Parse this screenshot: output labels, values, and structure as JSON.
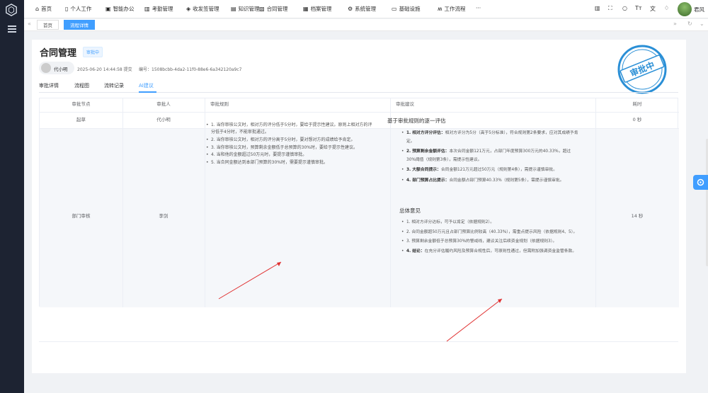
{
  "nav": [
    {
      "icon": "home-icon",
      "label": "首页"
    },
    {
      "icon": "person-icon",
      "label": "个人工作"
    },
    {
      "icon": "office-icon",
      "label": "智能办公"
    },
    {
      "icon": "chart-icon",
      "label": "考勤管理"
    },
    {
      "icon": "mail-icon",
      "label": "收发签管理"
    },
    {
      "icon": "book-icon",
      "label": "知识管理"
    },
    {
      "icon": "contract-icon",
      "label": "合同管理"
    },
    {
      "icon": "archive-icon",
      "label": "档案管理"
    },
    {
      "icon": "gear-icon",
      "label": "系统管理"
    },
    {
      "icon": "monitor-icon",
      "label": "基础设施"
    },
    {
      "icon": "workflow-icon",
      "label": "工作流程"
    },
    {
      "icon": "more-icon",
      "label": "···"
    }
  ],
  "user": {
    "name": "君风"
  },
  "tabs": {
    "home": "首页",
    "active": "流程详情"
  },
  "page": {
    "title": "合同管理",
    "status": "审批中",
    "applicant": "代小明",
    "submitted": "2025-06-20 14:44:58 提交",
    "number": "编号：1508bcbb-4da2-11f0-88e6-6a342120a9c7",
    "stamp": "审批中"
  },
  "detail_tabs": [
    "审批详情",
    "流程图",
    "流转记录",
    "AI建议"
  ],
  "table": {
    "headers": [
      "审批节点",
      "审批人",
      "审批规则",
      "审批建议",
      "耗时"
    ],
    "row1": {
      "node": "起草",
      "approver": "代小明",
      "time": "0 秒"
    },
    "row2": {
      "node": "部门审核",
      "approver": "李剑",
      "time": "14 秒"
    }
  },
  "rules": [
    "1. 当你审核公文时，相对方的评分低于5分时，要给于提示性建议。原则上相对方的评分低于4分时，不能审批通过。",
    "2. 当你审核公文时，相对方的评分高于5分时，要对想对方的成绩给予肯定。",
    "3. 当你审核公文时，预算剩余金额低于总预算的30%时，要给于提示性建议。",
    "4. 当和他的金额超过50万元时，要提示谨慎审批。",
    "5. 当合同金额达到本部门预算的30%时，需要提示谨慎审批。"
  ],
  "advice": {
    "title": "基于审批规则的逐一评估",
    "items": [
      {
        "bold": "1. 相对方评分评估：",
        "text": "相对方评分为5分（高于5分标准），符合规则第2条要求，应对其成绩予肯定。"
      },
      {
        "bold": "2. 预算剩余金额评估：",
        "text": "本次合同金额121万元，占部门年度预算300万元的40.33%，超过30%阈值（规则第3条），需提示性建议。"
      },
      {
        "bold": "3. 大额合同提示：",
        "text": "合同金额121万元超过50万元（规则第4条），需提示谨慎审批。"
      },
      {
        "bold": "4. 部门预算占比提示：",
        "text": "合同金额占部门预算40.33%（规则第5条），需提示谨慎审批。"
      }
    ],
    "summary_title": "总体意见",
    "summary": [
      {
        "bold": "",
        "text": "1. 相对方评分达标，可予以肯定（依据规则2）。"
      },
      {
        "bold": "",
        "text": "2. 合同金额超50万元且占部门预算比例较高（40.33%），需重点提示风险（依据规则4、5）。"
      },
      {
        "bold": "",
        "text": "3. 预算剩余金额低于总预算30%的警戒线，建议关注后续资金规划（依据规则3）。"
      },
      {
        "bold": "4. 结论：",
        "text": "在充分评估履约风险及预算合规性后，可原则性通过，但需附加强调资金监管条款。"
      }
    ]
  },
  "colors": {
    "primary": "#409eff",
    "sidebar": "#1d2332",
    "stamp": "#2a8fd6",
    "arrow": "#e03030"
  }
}
